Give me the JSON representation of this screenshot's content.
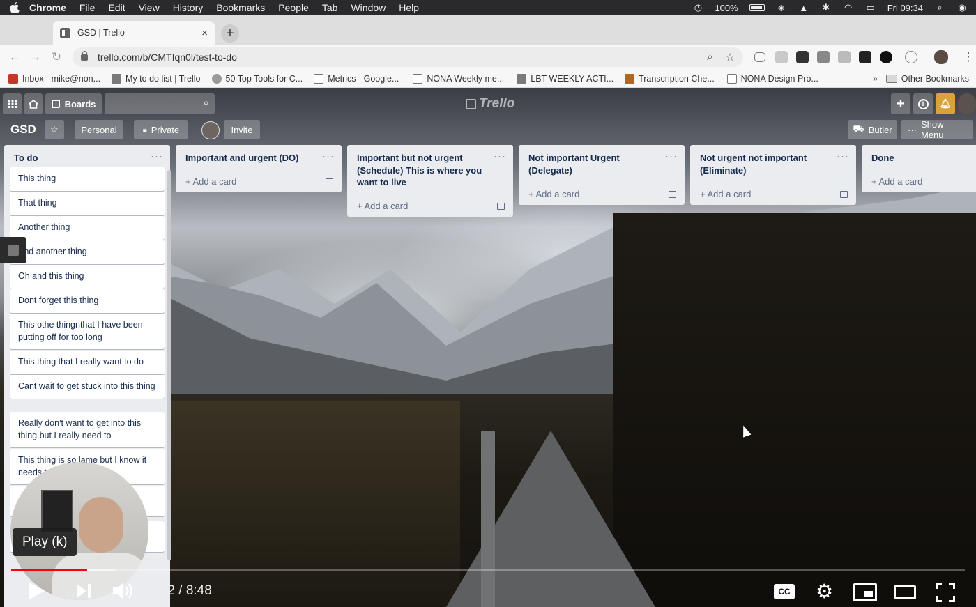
{
  "macbar": {
    "app": "Chrome",
    "menus": [
      "File",
      "Edit",
      "View",
      "History",
      "Bookmarks",
      "People",
      "Tab",
      "Window",
      "Help"
    ],
    "battery": "100%",
    "clock": "Fri 09:34"
  },
  "browser": {
    "tab_title": "GSD | Trello",
    "tab_close": "×",
    "new_tab": "+",
    "url": "trello.com/b/CMTIqn0l/test-to-do",
    "bookmarks": [
      "Inbox - mike@non...",
      "My to do list | Trello",
      "50 Top Tools for C...",
      "Metrics - Google...",
      "NONA Weekly me...",
      "LBT WEEKLY ACTI...",
      "Transcription Che...",
      "NONA Design Pro..."
    ],
    "bookmarks_overflow": "»",
    "other_bookmarks": "Other Bookmarks"
  },
  "trello": {
    "boards_label": "Boards",
    "logo": "Trello",
    "board_name": "GSD",
    "personal_label": "Personal",
    "private_label": "Private",
    "invite_label": "Invite",
    "butler_label": "Butler",
    "show_menu_label": "Show Menu",
    "list_menu": "···",
    "add_card": "+ Add a card",
    "lists": [
      {
        "title": "To do",
        "cards": [
          "This thing",
          "That thing",
          "Another thing",
          "And another thing",
          "Oh and this thing",
          "Dont forget this thing",
          "This othe thingnthat I have been putting off for too long",
          "This thing that I really want to do",
          "Cant wait to get stuck into this thing",
          "Really don't want to get into this thing but I really need to",
          "This thing is so lame but I know it needs to"
        ]
      },
      {
        "title": "Important and urgent (DO)"
      },
      {
        "title": "Important but not urgent (Schedule) This is where you want to live"
      },
      {
        "title": "Not important Urgent (Delegate)"
      },
      {
        "title": "Not urgent not important (Eliminate)"
      },
      {
        "title": "Done"
      }
    ]
  },
  "player": {
    "tooltip": "Play (k)",
    "time": "0:42 / 8:48",
    "cc": "CC",
    "played_fraction": 0.08,
    "buffered_fraction": 0.11
  },
  "colors": {
    "list_bg": "#ebecf0",
    "card_text": "#172b4d",
    "progress_red": "#ff0000"
  },
  "icons": {
    "macbar": "apple-icon",
    "header": [
      "apps-grid-icon",
      "home-icon",
      "board-icon",
      "search-icon",
      "plus-icon",
      "info-icon",
      "bell-icon"
    ],
    "player": [
      "play-icon",
      "next-icon",
      "volume-icon",
      "settings-gear-icon",
      "miniplayer-icon",
      "theater-icon",
      "fullscreen-icon"
    ]
  }
}
